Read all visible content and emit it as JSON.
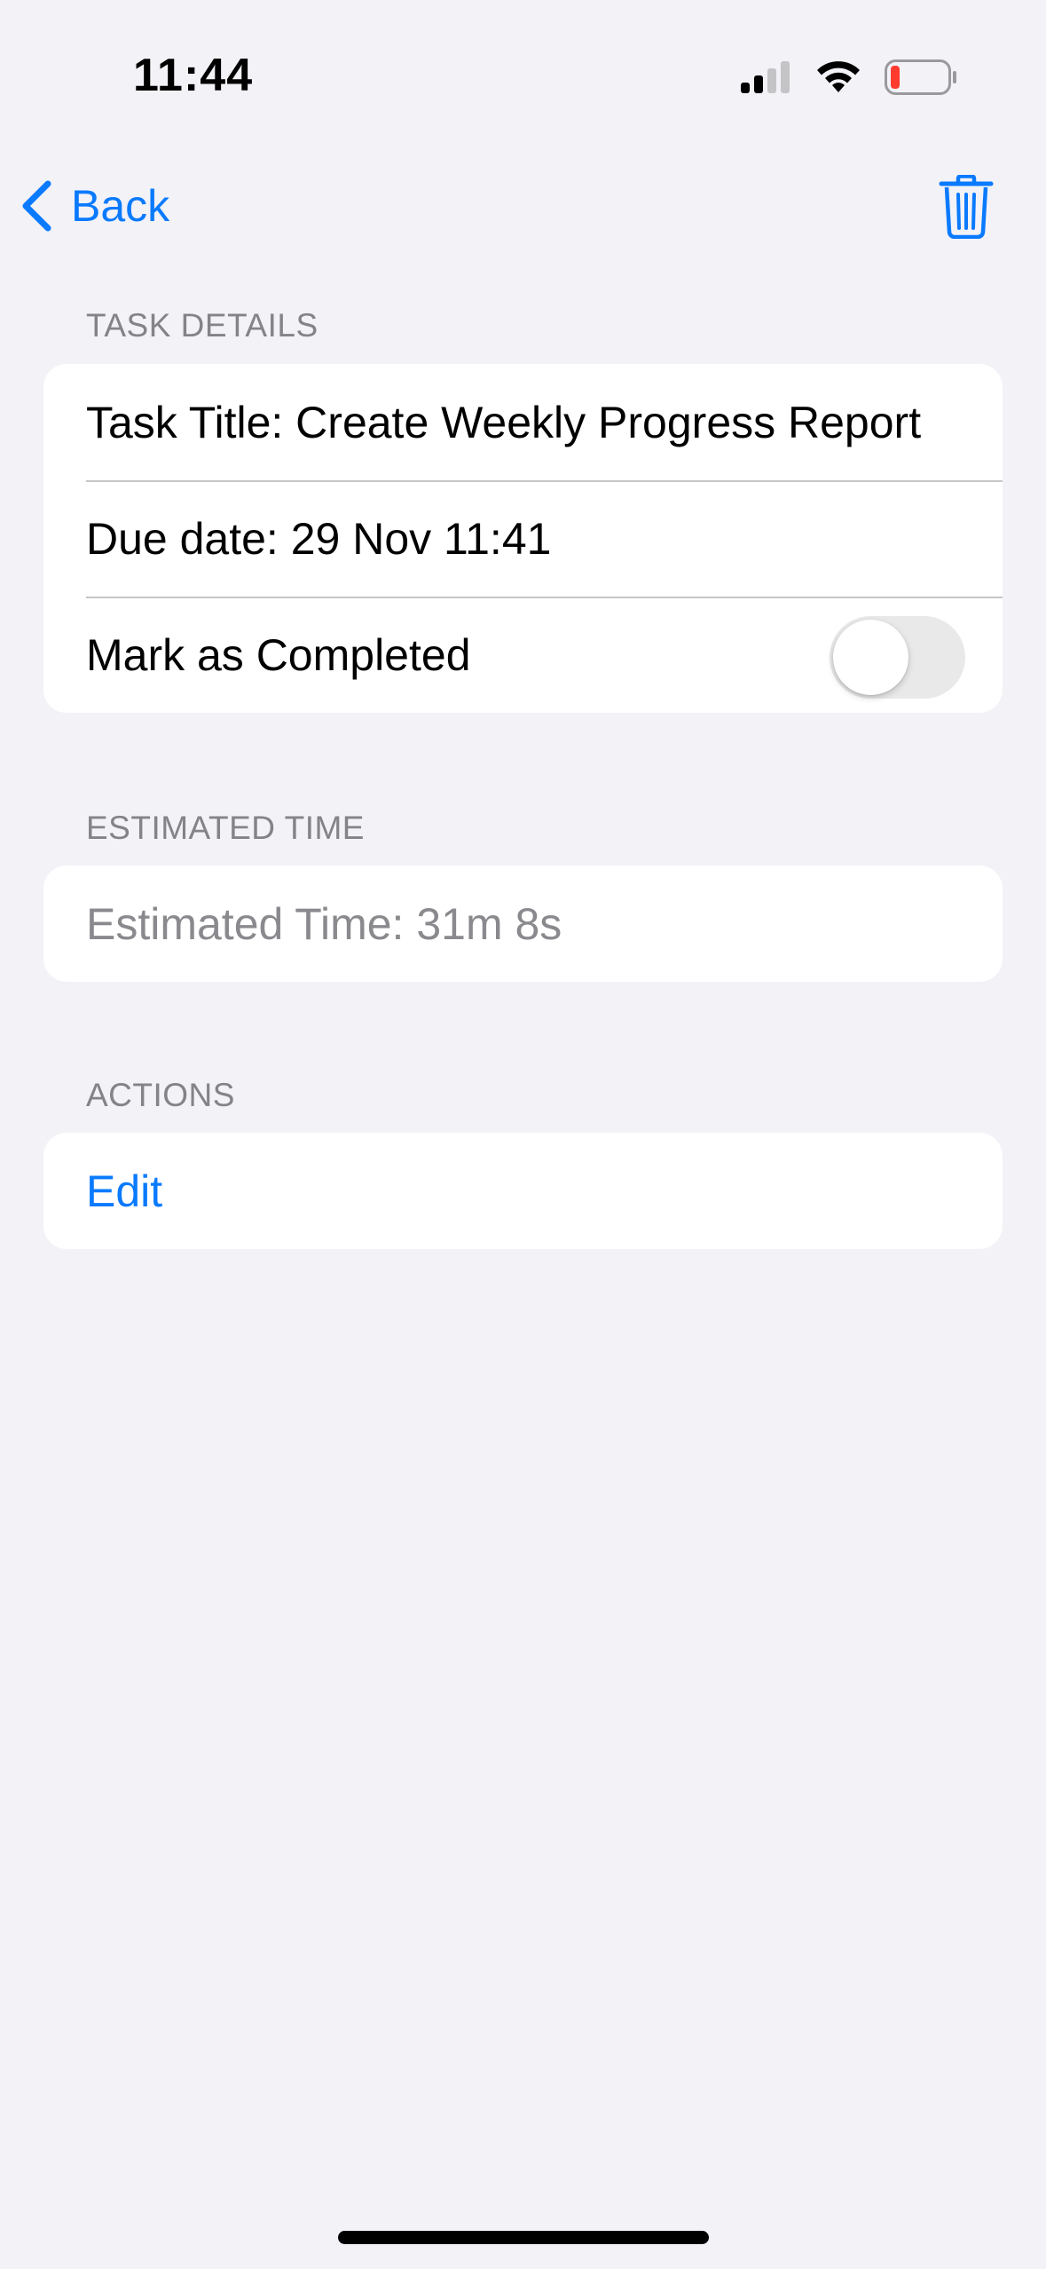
{
  "status_bar": {
    "time": "11:44",
    "signal_icon": "cellular-signal-icon",
    "wifi_icon": "wifi-icon",
    "battery_icon": "battery-low-icon",
    "battery_color": "#ff3b30"
  },
  "nav": {
    "back_label": "Back",
    "back_icon": "chevron-left-icon",
    "delete_icon": "trash-icon",
    "accent_color": "#0a7aff"
  },
  "task_details": {
    "header": "TASK DETAILS",
    "title_row": "Task Title: Create Weekly Progress Report",
    "due_row": "Due date: 29 Nov 11:41",
    "completed_label": "Mark as Completed",
    "completed": false
  },
  "estimated_time": {
    "header": "ESTIMATED TIME",
    "value_row": "Estimated Time: 31m 8s"
  },
  "actions": {
    "header": "ACTIONS",
    "edit_label": "Edit"
  }
}
